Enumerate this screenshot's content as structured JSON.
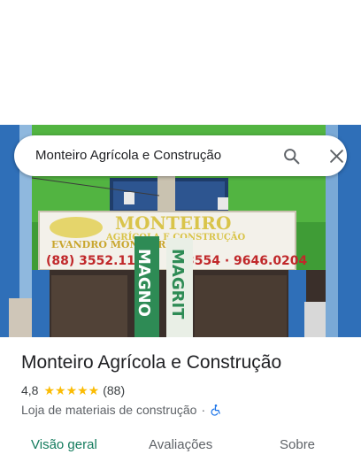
{
  "search": {
    "query": "Monteiro Agrícola e Construção"
  },
  "place": {
    "name": "Monteiro Agrícola e Construção",
    "rating": "4,8",
    "stars": "★★★★★",
    "review_count": "(88)",
    "category": "Loja de materiais de construção",
    "separator": "·"
  },
  "photo": {
    "sign_top": "MONTEIRO",
    "sign_sub": "AGRÍCOLA E CONSTRUÇÃO",
    "sign_owner": "EVANDRO MONTEIRO",
    "sign_phone_left": "(88) 3552.1137",
    "sign_phone_right": "3554 · 9646.0204",
    "banner_left": "MAGNO",
    "banner_right": "MAGRIT"
  },
  "tabs": [
    {
      "label": "Visão geral",
      "active": true
    },
    {
      "label": "Avaliações",
      "active": false
    },
    {
      "label": "Sobre",
      "active": false
    }
  ],
  "colors": {
    "accent": "#137b5d",
    "star": "#fbbc04",
    "accessibility": "#1a73e8",
    "wall": "#4aa83a"
  },
  "icons": {
    "search": "search-icon",
    "close": "close-icon",
    "accessibility": "wheelchair-icon"
  }
}
